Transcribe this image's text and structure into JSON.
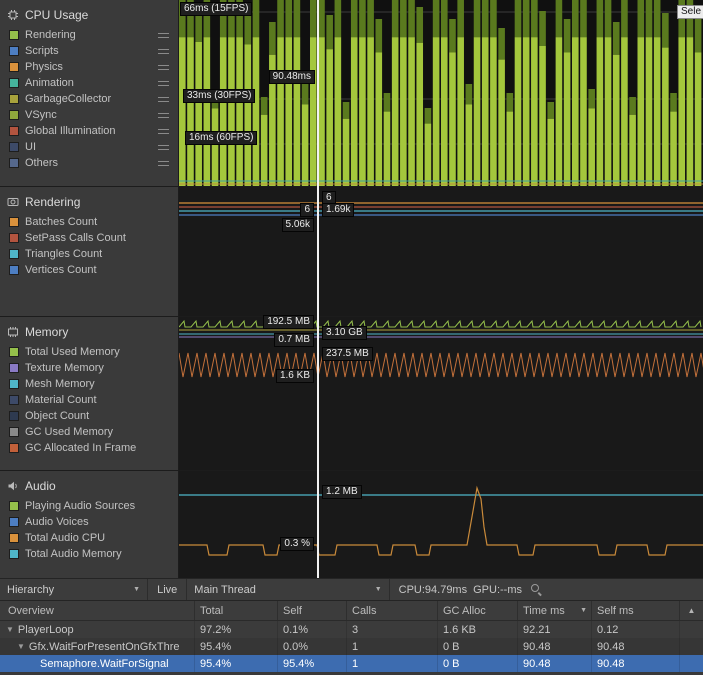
{
  "window": {
    "selected_tooltip": "Sele"
  },
  "modules": [
    {
      "id": "cpu",
      "title": "CPU Usage",
      "legend": [
        {
          "label": "Rendering",
          "color": "#95c04b",
          "handle": true
        },
        {
          "label": "Scripts",
          "color": "#4d7ec2",
          "handle": true
        },
        {
          "label": "Physics",
          "color": "#d9913c",
          "handle": true
        },
        {
          "label": "Animation",
          "color": "#45b39c",
          "handle": true
        },
        {
          "label": "GarbageCollector",
          "color": "#a8a23c",
          "handle": true
        },
        {
          "label": "VSync",
          "color": "#8fa83c",
          "handle": true
        },
        {
          "label": "Global Illumination",
          "color": "#b2543f",
          "handle": true
        },
        {
          "label": "UI",
          "color": "#3d4a68",
          "handle": true
        },
        {
          "label": "Others",
          "color": "#55688c",
          "handle": true
        }
      ]
    },
    {
      "id": "rendering",
      "title": "Rendering",
      "legend": [
        {
          "label": "Batches Count",
          "color": "#d9913c"
        },
        {
          "label": "SetPass Calls Count",
          "color": "#b2543f"
        },
        {
          "label": "Triangles Count",
          "color": "#4fb6c9"
        },
        {
          "label": "Vertices Count",
          "color": "#4d7ec2"
        }
      ]
    },
    {
      "id": "memory",
      "title": "Memory",
      "legend": [
        {
          "label": "Total Used Memory",
          "color": "#95c04b"
        },
        {
          "label": "Texture Memory",
          "color": "#8a7ac4"
        },
        {
          "label": "Mesh Memory",
          "color": "#4fb6c9"
        },
        {
          "label": "Material Count",
          "color": "#3d4a68"
        },
        {
          "label": "Object Count",
          "color": "#2e3a50"
        },
        {
          "label": "GC Used Memory",
          "color": "#8a8a8a"
        },
        {
          "label": "GC Allocated In Frame",
          "color": "#c2603a"
        }
      ]
    },
    {
      "id": "audio",
      "title": "Audio",
      "legend": [
        {
          "label": "Playing Audio Sources",
          "color": "#95c04b"
        },
        {
          "label": "Audio Voices",
          "color": "#4d7ec2"
        },
        {
          "label": "Total Audio CPU",
          "color": "#d9913c"
        },
        {
          "label": "Total Audio Memory",
          "color": "#4fb6c9"
        }
      ]
    }
  ],
  "cpu_chart": {
    "bar_color": "#a4c73c",
    "bar_top_color": "#5a7a1e",
    "labels": {
      "l66": "66ms (15FPS)",
      "l33": "33ms (30FPS)",
      "l16": "16ms (60FPS)",
      "selected": "90.48ms"
    },
    "bars": [
      1,
      1,
      0.97,
      1,
      0.52,
      1,
      1,
      1,
      0.95,
      1,
      0.48,
      0.88,
      1,
      1,
      1,
      0.55,
      1,
      1,
      0.92,
      1,
      0.45,
      1,
      1,
      1,
      0.9,
      0.5,
      1,
      1,
      1,
      0.96,
      0.42,
      1,
      1,
      0.9,
      1,
      0.55,
      1,
      1,
      1,
      0.85,
      0.5,
      1,
      1,
      1,
      0.94,
      0.45,
      1,
      0.9,
      1,
      1,
      0.52,
      1,
      1,
      0.88,
      1,
      0.48,
      1,
      1,
      1,
      0.93,
      0.5,
      1,
      1,
      0.9
    ]
  },
  "rendering_chart": {
    "labels": {
      "left_val": "6",
      "left_bottom": "5.06k",
      "right_val": "6",
      "right_bottom": "1.69k"
    }
  },
  "memory_chart": {
    "labels": {
      "l1": "192.5 MB",
      "l2": "0.7 MB",
      "l3": "1.6 KB",
      "r1": "3.10 GB",
      "r2": "237.5 MB"
    }
  },
  "audio_chart": {
    "labels": {
      "l1": "0.3 %",
      "r1": "1.2 MB"
    }
  },
  "toolbar": {
    "hierarchy": "Hierarchy",
    "live": "Live",
    "thread": "Main Thread",
    "cpu_stat": "CPU:94.79ms",
    "gpu_stat": "GPU:--ms"
  },
  "icons": {
    "dropdown": "▼",
    "fold_open": "▼",
    "sort": "▼",
    "scroll_up": "▲"
  },
  "table": {
    "columns": [
      "Overview",
      "Total",
      "Self",
      "Calls",
      "GC Alloc",
      "Time ms",
      "Self ms"
    ],
    "rows": [
      {
        "name": "PlayerLoop",
        "fold": "▼",
        "depth": 0,
        "selected": false,
        "values": [
          "97.2%",
          "0.1%",
          "3",
          "1.6 KB",
          "92.21",
          "0.12"
        ]
      },
      {
        "name": "Gfx.WaitForPresentOnGfxThre",
        "fold": "▼",
        "depth": 1,
        "selected": false,
        "values": [
          "95.4%",
          "0.0%",
          "1",
          "0 B",
          "90.48",
          "90.48"
        ]
      },
      {
        "name": "Semaphore.WaitForSignal",
        "fold": "",
        "depth": 2,
        "selected": true,
        "values": [
          "95.4%",
          "95.4%",
          "1",
          "0 B",
          "90.48",
          "90.48"
        ]
      }
    ]
  }
}
